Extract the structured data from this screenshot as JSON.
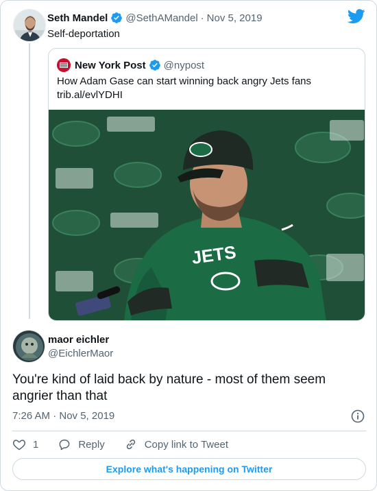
{
  "parent": {
    "name": "Seth Mandel",
    "handle": "@SethAMandel",
    "separator": "·",
    "date": "Nov 5, 2019",
    "text": "Self-deportation"
  },
  "quote": {
    "name": "New York Post",
    "handle": "@nypost",
    "text": "How Adam Gase can start winning back angry Jets fans",
    "link": "trib.al/evlYDHI"
  },
  "main": {
    "name": "maor eichler",
    "handle": "@EichlerMaor",
    "text": "You're kind of laid back by nature - most of them seem angrier than that",
    "timestamp": "7:26 AM · Nov 5, 2019"
  },
  "actions": {
    "like_count": "1",
    "reply_label": "Reply",
    "copy_label": "Copy link to Tweet"
  },
  "explore_label": "Explore what's happening on Twitter",
  "colors": {
    "twitter_blue": "#1d9bf0",
    "jets_green": "#1f5c3c",
    "text_secondary": "#536471",
    "border": "#cfd9de",
    "nypost_red": "#c8102e"
  },
  "icons": [
    "twitter-bird-icon",
    "verified-badge-icon",
    "heart-icon",
    "reply-icon",
    "link-icon",
    "info-icon"
  ]
}
